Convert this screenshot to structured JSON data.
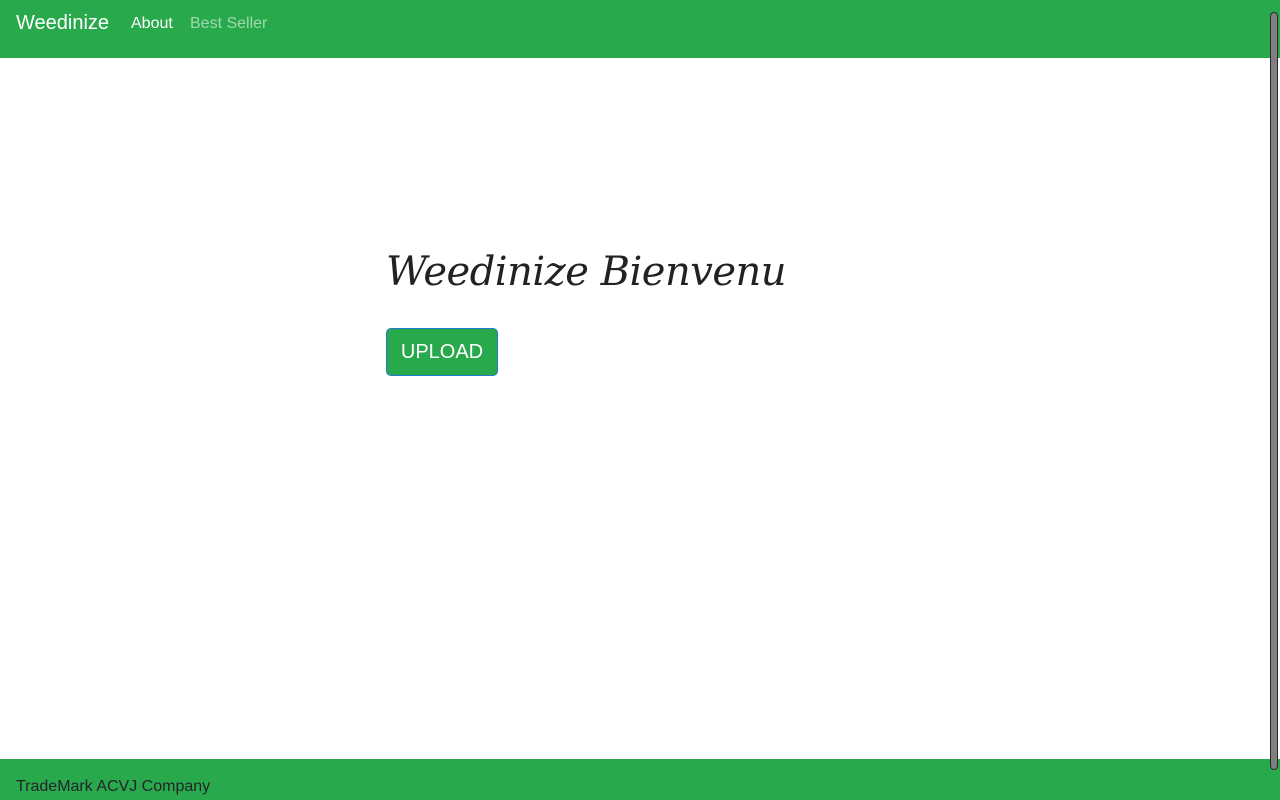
{
  "navbar": {
    "brand": "Weedinize",
    "links": [
      {
        "label": "About",
        "active": true
      },
      {
        "label": "Best Seller",
        "active": false
      }
    ]
  },
  "hero": {
    "title": "Weedinize Bienvenu",
    "upload_label": "UPLOAD"
  },
  "footer": {
    "text": "TradeMark ACVJ Company"
  },
  "colors": {
    "brand_green": "#28a94c",
    "button_border": "#1f7ad0",
    "text_dark": "#212529"
  }
}
